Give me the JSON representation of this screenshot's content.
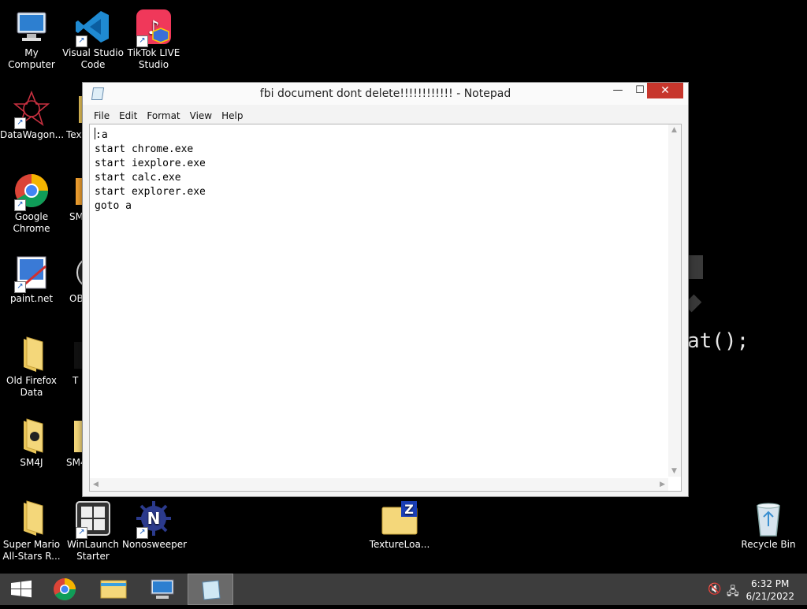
{
  "desktop": {
    "icons": [
      {
        "label": "My Computer"
      },
      {
        "label": "Visual Studio Code"
      },
      {
        "label": "TikTok LIVE Studio"
      },
      {
        "label": "DataWagon..."
      },
      {
        "label": "Text"
      },
      {
        "label": "Google Chrome"
      },
      {
        "label": "SM"
      },
      {
        "label": "paint.net"
      },
      {
        "label": "OB"
      },
      {
        "label": "Old Firefox Data"
      },
      {
        "label": "T"
      },
      {
        "label": "SM4J"
      },
      {
        "label": "SM4"
      },
      {
        "label": "Super Mario All-Stars R..."
      },
      {
        "label": "WinLaunch Starter"
      },
      {
        "label": "Nonosweeper"
      },
      {
        "label": "TextureLoa..."
      },
      {
        "label": "Recycle Bin"
      }
    ],
    "wallpaper_text": "at();"
  },
  "notepad": {
    "title": "fbi document dont delete!!!!!!!!!!!! - Notepad",
    "controls": {
      "minimize": "—",
      "maximize": "☐",
      "close": "✕"
    },
    "menu": [
      "File",
      "Edit",
      "Format",
      "View",
      "Help"
    ],
    "content_first_line": ":a",
    "content_rest": "start chrome.exe\nstart iexplore.exe\nstart calc.exe\nstart explorer.exe\ngoto a"
  },
  "taskbar": {
    "time": "6:32 PM",
    "date": "6/21/2022"
  },
  "colors": {
    "close_button": "#c7362c",
    "taskbar": "#3d3d3d",
    "desktop": "#000000"
  }
}
